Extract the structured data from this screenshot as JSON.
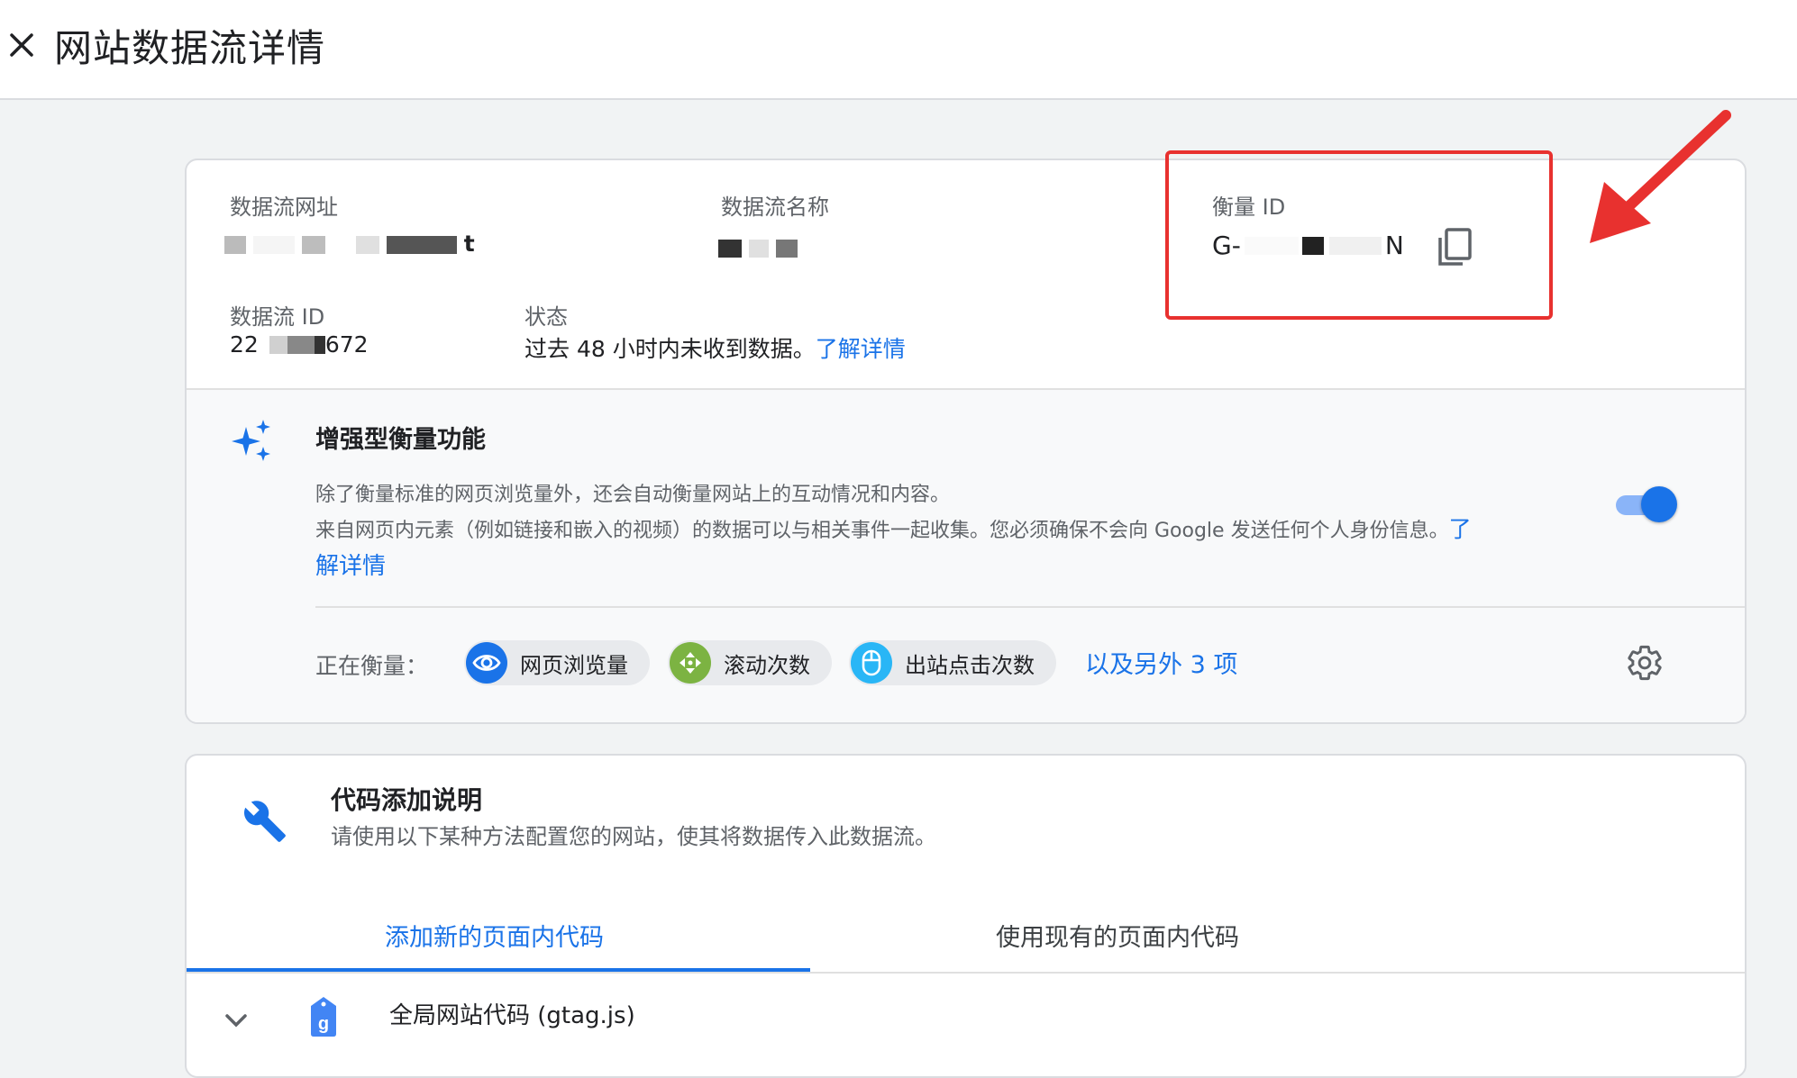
{
  "header": {
    "title": "网站数据流详情"
  },
  "stream": {
    "url_label": "数据流网址",
    "url_value_tail": "t",
    "name_label": "数据流名称",
    "measurement_id_label": "衡量 ID",
    "measurement_id_prefix": "G-",
    "measurement_id_suffix": "N",
    "id_label": "数据流 ID",
    "id_prefix": "22",
    "id_suffix": "672",
    "status_label": "状态",
    "status_text": "过去 48 小时内未收到数据。",
    "status_link": "了解详情"
  },
  "enhanced": {
    "title": "增强型衡量功能",
    "desc_line1": "除了衡量标准的网页浏览量外，还会自动衡量网站上的互动情况和内容。",
    "desc_line2": "来自网页内元素（例如链接和嵌入的视频）的数据可以与相关事件一起收集。您必须确保不会向 Google 发送任何个人身份信息。",
    "desc_link_part1": "了",
    "desc_link_part2": "解详情",
    "enabled": true,
    "measuring_label": "正在衡量：",
    "chips": [
      "网页浏览量",
      "滚动次数",
      "出站点击次数"
    ],
    "more_link": "以及另外 3 项"
  },
  "code_setup": {
    "title": "代码添加说明",
    "subtitle": "请使用以下某种方法配置您的网站，使其将数据传入此数据流。",
    "tabs": [
      "添加新的页面内代码",
      "使用现有的页面内代码"
    ],
    "active_tab": 0,
    "row_label": "全局网站代码 (gtag.js)"
  },
  "colors": {
    "accent": "#1a73e8",
    "annotation": "#e8312f",
    "scroll_icon": "#7cb342",
    "outbound_icon": "#29b6f6"
  },
  "icons": {
    "close": "close-icon",
    "copy": "copy-icon",
    "sparkle": "sparkle-icon",
    "eye": "eye-icon",
    "scroll": "scroll-icon",
    "mouse": "mouse-icon",
    "gear": "gear-icon",
    "wrench": "wrench-icon",
    "tag": "tag-icon",
    "chevron": "chevron-down-icon"
  }
}
